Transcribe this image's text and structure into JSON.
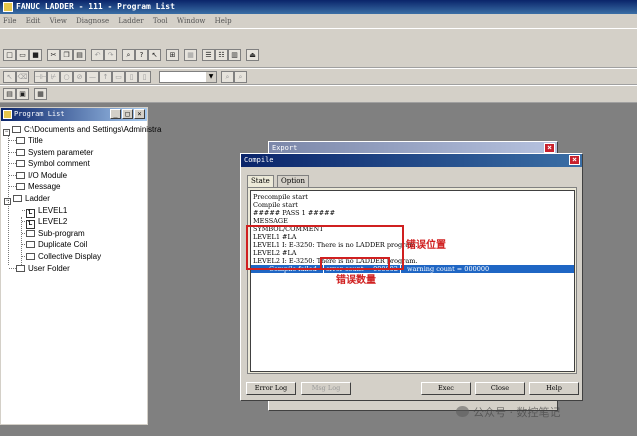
{
  "window": {
    "title": "FANUC LADDER - 111 - Program List"
  },
  "menu": [
    "File",
    "Edit",
    "View",
    "Diagnose",
    "Ladder",
    "Tool",
    "Window",
    "Help"
  ],
  "program_list": {
    "title": "Program List",
    "root": "C:\\Documents and Settings\\Administra",
    "items": {
      "title": "Title",
      "system_parameter": "System parameter",
      "symbol_comment": "Symbol comment",
      "io_module": "I/O Module",
      "message": "Message",
      "ladder": "Ladder",
      "level1": "LEVEL1",
      "level2": "LEVEL2",
      "sub_program": "Sub-program",
      "duplicate_coil": "Duplicate Coil",
      "collective_display": "Collective Display",
      "user_folder": "User Folder"
    },
    "ladder_glyph": "L"
  },
  "export_dialog": {
    "title": "Export"
  },
  "compile_dialog": {
    "title": "Compile",
    "tabs": [
      "State",
      "Option"
    ],
    "log": [
      "Precompile start",
      "Compile start",
      "##### PASS 1 #####",
      "MESSAGE",
      "SYMBOL/COMMENT",
      "LEVEL1 #LA",
      "LEVEL1 I: E-3250: There is no LADDER program.",
      "LEVEL2 #LA",
      "LEVEL2 I: E-3250: There is no LADDER program."
    ],
    "result": {
      "status": "Compile failed",
      "error_count": "error count = 000002",
      "warning_count": "warning count = 000000"
    },
    "buttons": {
      "error_log": "Error Log",
      "msg_log": "Msg Log",
      "exec": "Exec",
      "close": "Close",
      "help": "Help"
    }
  },
  "annotations": {
    "error_position": "错误位置",
    "error_count": "错误数量"
  },
  "watermarks": {
    "site": "www.sk12.com",
    "wechat": "公众号 · 数控笔记"
  },
  "colors": {
    "title_active": "#0a246a",
    "selection": "#1f66c4",
    "annotation": "#d02020",
    "close_button": "#c8202c"
  }
}
